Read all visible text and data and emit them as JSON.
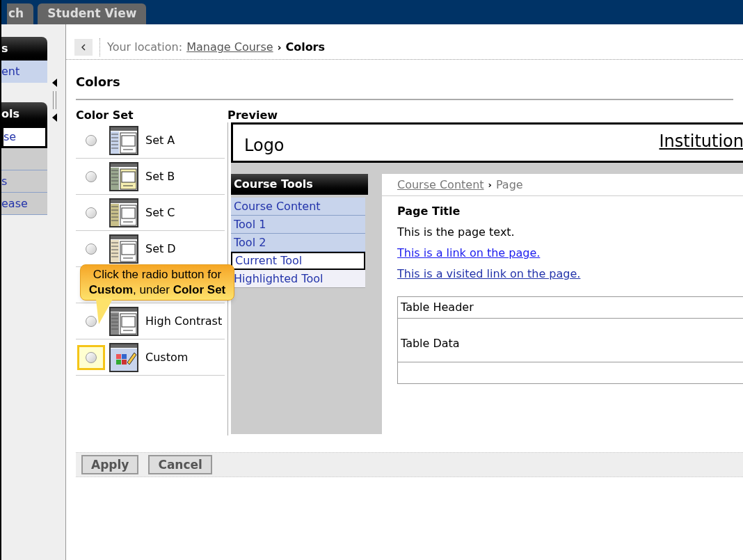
{
  "tabs": [
    {
      "label": "ch",
      "selected": false
    },
    {
      "label": "Student View",
      "selected": false
    }
  ],
  "sidebar": {
    "panels": [
      {
        "title": "s",
        "items": [
          {
            "label": "ent",
            "selected": true
          }
        ]
      },
      {
        "title": "ols",
        "items": [
          {
            "label": "se",
            "selected": true
          },
          {
            "selected": false
          },
          {
            "label": "s",
            "selected": false
          },
          {
            "label": "ease",
            "selected": false
          }
        ]
      }
    ]
  },
  "breadcrumb": {
    "prefix": "Your location:",
    "link": "Manage Course",
    "separator": "›",
    "current": "Colors"
  },
  "page_title": "Colors",
  "color_set": {
    "heading": "Color Set",
    "options": [
      {
        "label": "Set A",
        "kind": "preset",
        "selected": false,
        "highlighted": false
      },
      {
        "label": "Set B",
        "kind": "preset",
        "selected": false,
        "highlighted": false
      },
      {
        "label": "Set C",
        "kind": "preset",
        "selected": false,
        "highlighted": false
      },
      {
        "label": "Set D",
        "kind": "preset",
        "selected": false,
        "highlighted": false
      },
      {
        "label": "High Contrast",
        "kind": "preset",
        "selected": false,
        "highlighted": false
      },
      {
        "label": "Custom",
        "kind": "custom",
        "selected": false,
        "highlighted": true
      }
    ]
  },
  "preview": {
    "heading": "Preview",
    "logo": "Logo",
    "institution": "Institution",
    "menu_title": "Course Tools",
    "menu_items": [
      {
        "label": "Course Content",
        "kind": "normal"
      },
      {
        "label": "Tool 1",
        "kind": "normal"
      },
      {
        "label": "Tool 2",
        "kind": "normal"
      },
      {
        "label": "Current Tool",
        "kind": "current"
      },
      {
        "label": "Highlighted Tool",
        "kind": "highlighted"
      }
    ],
    "breadcrumb": {
      "link": "Course Content",
      "separator": "›",
      "current": "Page"
    },
    "page_title": "Page Title",
    "page_text": "This is the page text.",
    "links": [
      {
        "label": "This is a link on the page.",
        "visited": false
      },
      {
        "label": "This is a visited link on the page.",
        "visited": true
      }
    ],
    "table": {
      "header": "Table Header",
      "data": "Table Data"
    }
  },
  "buttons": [
    "Apply",
    "Cancel"
  ],
  "callout": {
    "text": "Click the radio button for **Custom**, under **Color Set**"
  }
}
